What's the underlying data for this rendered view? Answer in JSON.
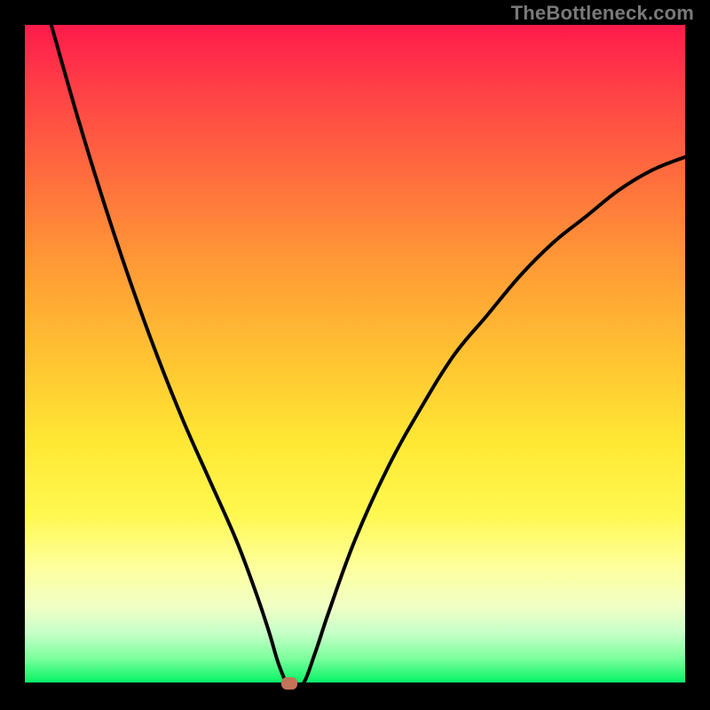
{
  "watermark": "TheBottleneck.com",
  "colors": {
    "frame": "#000000",
    "curve": "#000000",
    "marker": "#c47258",
    "gradient_stops": [
      "#ff1a4b",
      "#ff3a48",
      "#ff6a3e",
      "#ff9936",
      "#ffc232",
      "#ffe733",
      "#fff84f",
      "#feff9b",
      "#f1ffc5",
      "#c8ffc8",
      "#7bff9c",
      "#18f56e",
      "#00e86c"
    ]
  },
  "chart_data": {
    "type": "line",
    "title": "",
    "xlabel": "",
    "ylabel": "",
    "x_range": [
      0,
      100
    ],
    "y_range": [
      0,
      100
    ],
    "grid": false,
    "legend": false,
    "series": [
      {
        "name": "curve",
        "x": [
          4,
          8,
          12,
          16,
          20,
          24,
          28,
          32,
          35,
          37,
          38.5,
          40,
          42,
          44,
          46,
          50,
          55,
          60,
          65,
          70,
          75,
          80,
          85,
          90,
          95,
          100
        ],
        "y": [
          100,
          86,
          73,
          61,
          50,
          40,
          31,
          22,
          14,
          8,
          3,
          0,
          0,
          5,
          11,
          22,
          33,
          42,
          50,
          56,
          62,
          67,
          71,
          75,
          78,
          80
        ]
      }
    ],
    "annotations": [
      {
        "name": "minimum-marker",
        "x": 40,
        "y": 0
      }
    ],
    "notes": "V-shaped bottleneck curve over red→green vertical gradient; values estimated from pixel positions."
  }
}
